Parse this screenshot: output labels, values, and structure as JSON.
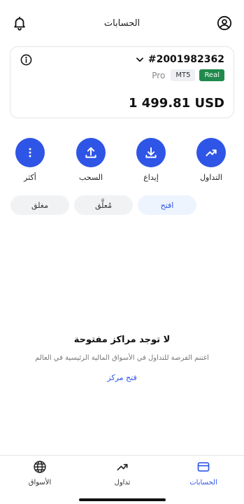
{
  "header": {
    "title": "الحسابات",
    "bell_icon": "bell-icon",
    "profile_icon": "user-circle-icon"
  },
  "account_card": {
    "account_number": "#2001982362",
    "type_label": "Pro",
    "platform_tag": "MT5",
    "mode_tag": "Real",
    "balance": "1 499.81 USD",
    "info_icon": "info-icon",
    "expand_icon": "chevron-down-icon"
  },
  "actions": [
    {
      "label": "التداول",
      "icon": "trend-up-icon"
    },
    {
      "label": "إيداع",
      "icon": "download-icon"
    },
    {
      "label": "السحب",
      "icon": "upload-icon"
    },
    {
      "label": "أكثر",
      "icon": "more-vertical-icon"
    }
  ],
  "filters": [
    {
      "label": "افتح",
      "active": true
    },
    {
      "label": "مُعلَّق",
      "active": false
    },
    {
      "label": "مغلق",
      "active": false
    }
  ],
  "empty_state": {
    "title": "لا توجد مراكز مفتوحة",
    "subtitle": "اغتنم الفرصة للتداول في الأسواق المالية الرئيسية في العالم",
    "link": "فتح مركز"
  },
  "bottom_nav": [
    {
      "label": "الحسابات",
      "icon": "card-icon",
      "active": true
    },
    {
      "label": "تداول",
      "icon": "trend-up-icon",
      "active": false
    },
    {
      "label": "الأسواق",
      "icon": "globe-icon",
      "active": false
    }
  ],
  "colors": {
    "accent": "#2e55e6",
    "real_tag": "#1f8a4c",
    "active_pill_bg": "#eef4fd"
  }
}
